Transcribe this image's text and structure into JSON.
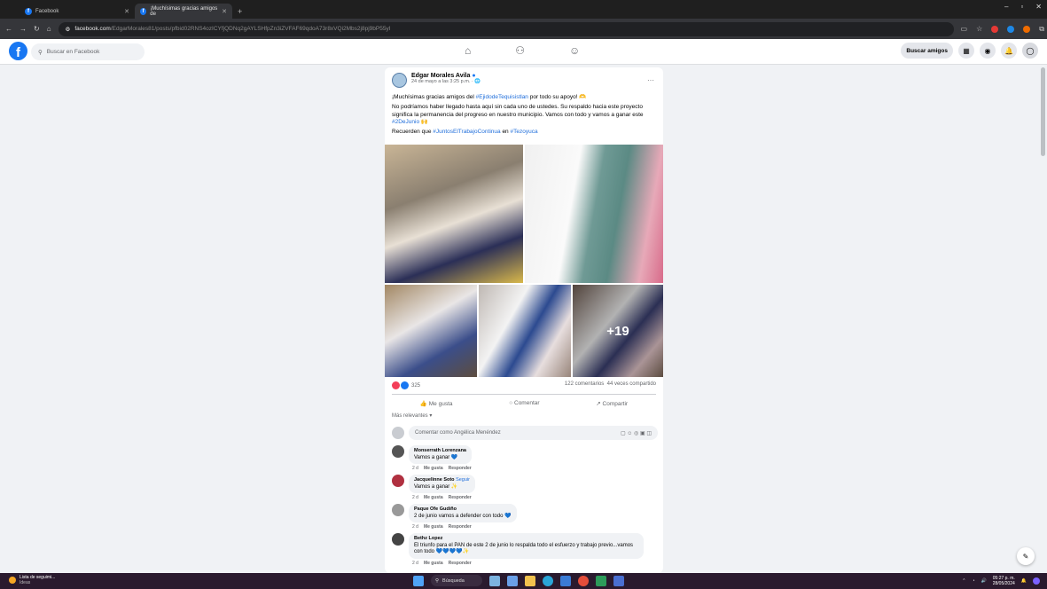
{
  "browser": {
    "tabs": [
      {
        "label": "Facebook"
      },
      {
        "label": "¡Muchísimas gracias amigos de"
      }
    ],
    "new_tab": "+",
    "url_domain": "facebook.com",
    "url_path": "/EdgarMorales81/posts/pfbid02RNS4ozICYfjQDNq2gAYLSHfpZn3iZVFAF69qdoA73r8xVQi2Mbs2j8pj9bP55yl",
    "window_controls": [
      "–",
      "▫",
      "✕"
    ]
  },
  "fb": {
    "search_placeholder": "Buscar en Facebook",
    "find_friends": "Buscar amigos",
    "nav": [
      "⌂",
      "⚇",
      "☺"
    ]
  },
  "post": {
    "author": "Edgar Morales Avila",
    "meta": "24 de mayo a las 3:25 p.m. · 🌐",
    "text1_a": "¡Muchísimas gracias amigos del ",
    "text1_tag": "#EjidodeTequisistlan",
    "text1_b": " por todo su apoyo! 🫶",
    "text2": "No podríamos haber llegado hasta aquí sin cada uno de ustedes. Su respaldo hacia este proyecto significa la permanencia del progreso en nuestro municipio. Vamos con todo y vamos a ganar este ",
    "text2_tag": "#2DeJunio",
    "text2_end": " 🙌",
    "text3_a": "Recuerden que ",
    "text3_tag1": "#JuntosElTrabajoContinua",
    "text3_b": " en ",
    "text3_tag2": "#Tezoyuca",
    "more_photos": "+19",
    "reactions": "325",
    "comments_count": "122 comentarios",
    "shares": "44 veces compartido",
    "like": "Me gusta",
    "comment": "Comentar",
    "share": "Compartir",
    "relevance": "Más relevantes ▾",
    "comment_placeholder": "Comentar como Angélica Menéndez"
  },
  "comments": [
    {
      "name": "Monserrath Lorenzana",
      "text": "Vamos a ganar 💙",
      "time": "2 d",
      "like": "Me gusta",
      "reply": "Responder",
      "color": "#555"
    },
    {
      "name": "Jacquelinne Soto",
      "follow": "Seguir",
      "text": "Vamos a ganar ✨",
      "time": "2 d",
      "like": "Me gusta",
      "reply": "Responder",
      "color": "#b03040"
    },
    {
      "name": "Paque Ofe Gudiño",
      "text": "2 de junio vamos a defender con todo 💙",
      "time": "2 d",
      "like": "Me gusta",
      "reply": "Responder",
      "color": "#999"
    },
    {
      "name": "Bethz Lopez",
      "text": "El triunfo para el PAN de este 2 de junio lo respalda todo el esfuerzo y trabajo previo...vamos con todo 💙💙💙💙✨",
      "time": "2 d",
      "like": "Me gusta",
      "reply": "Responder",
      "color": "#444"
    }
  ],
  "taskbar": {
    "weather_title": "Lista de seguimi...",
    "weather_sub": "Ideas",
    "search": "Búsqueda",
    "time": "05:27 p. m.",
    "date": "28/05/2024"
  }
}
